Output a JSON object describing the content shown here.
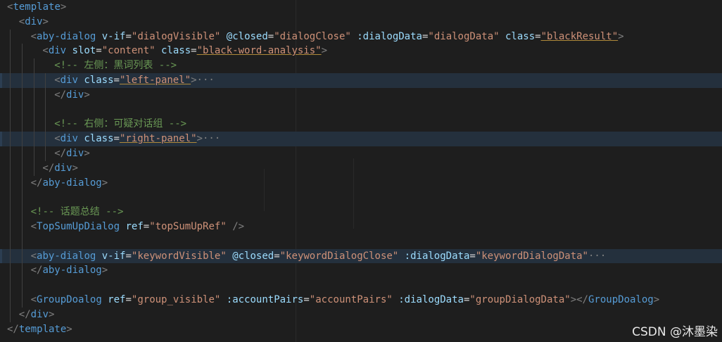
{
  "colors": {
    "background": "#1e1e1e",
    "tag": "#569cd6",
    "bracket": "#808080",
    "attr": "#9cdcfe",
    "equals": "#d4d4d4",
    "string": "#ce9178",
    "comment": "#6a9955",
    "fold": "#808080",
    "highlight": "#24303d"
  },
  "code_lines": [
    {
      "indent": 0,
      "tokens": [
        {
          "t": "<",
          "c": "bracket"
        },
        {
          "t": "template",
          "c": "tag"
        },
        {
          "t": ">",
          "c": "bracket"
        }
      ]
    },
    {
      "indent": 1,
      "tokens": [
        {
          "t": "<",
          "c": "bracket"
        },
        {
          "t": "div",
          "c": "tag"
        },
        {
          "t": ">",
          "c": "bracket"
        }
      ]
    },
    {
      "indent": 2,
      "tokens": [
        {
          "t": "<",
          "c": "bracket"
        },
        {
          "t": "aby-dialog",
          "c": "tag"
        },
        {
          "t": " v-if",
          "c": "attr"
        },
        {
          "t": "=",
          "c": "equals"
        },
        {
          "t": "\"dialogVisible\"",
          "c": "string"
        },
        {
          "t": " @closed",
          "c": "attr"
        },
        {
          "t": "=",
          "c": "equals"
        },
        {
          "t": "\"dialogClose\"",
          "c": "string"
        },
        {
          "t": " :dialogData",
          "c": "attr"
        },
        {
          "t": "=",
          "c": "equals"
        },
        {
          "t": "\"dialogData\"",
          "c": "string"
        },
        {
          "t": " class",
          "c": "attr"
        },
        {
          "t": "=",
          "c": "equals"
        },
        {
          "t": "\"blackResult\"",
          "c": "string"
        },
        {
          "t": ">",
          "c": "bracket"
        }
      ]
    },
    {
      "indent": 3,
      "tokens": [
        {
          "t": "<",
          "c": "bracket"
        },
        {
          "t": "div",
          "c": "tag"
        },
        {
          "t": " slot",
          "c": "attr"
        },
        {
          "t": "=",
          "c": "equals"
        },
        {
          "t": "\"content\"",
          "c": "string"
        },
        {
          "t": " class",
          "c": "attr"
        },
        {
          "t": "=",
          "c": "equals"
        },
        {
          "t": "\"black-word-analysis\"",
          "c": "string"
        },
        {
          "t": ">",
          "c": "bracket"
        }
      ]
    },
    {
      "indent": 4,
      "tokens": [
        {
          "t": "<!-- 左侧：黑词列表 -->",
          "c": "comment"
        }
      ]
    },
    {
      "indent": 4,
      "highlight": true,
      "tokens": [
        {
          "t": "<",
          "c": "bracket"
        },
        {
          "t": "div",
          "c": "tag"
        },
        {
          "t": " class",
          "c": "attr"
        },
        {
          "t": "=",
          "c": "equals"
        },
        {
          "t": "\"left-panel\"",
          "c": "string"
        },
        {
          "t": ">",
          "c": "bracket"
        },
        {
          "t": "···",
          "c": "fold"
        }
      ]
    },
    {
      "indent": 4,
      "tokens": [
        {
          "t": "</",
          "c": "bracket"
        },
        {
          "t": "div",
          "c": "tag"
        },
        {
          "t": ">",
          "c": "bracket"
        }
      ]
    },
    {
      "indent": 0,
      "tokens": []
    },
    {
      "indent": 4,
      "tokens": [
        {
          "t": "<!-- 右侧：可疑对话组 -->",
          "c": "comment"
        }
      ]
    },
    {
      "indent": 4,
      "highlight": true,
      "tokens": [
        {
          "t": "<",
          "c": "bracket"
        },
        {
          "t": "div",
          "c": "tag"
        },
        {
          "t": " class",
          "c": "attr"
        },
        {
          "t": "=",
          "c": "equals"
        },
        {
          "t": "\"right-panel\"",
          "c": "string"
        },
        {
          "t": ">",
          "c": "bracket"
        },
        {
          "t": "···",
          "c": "fold"
        }
      ]
    },
    {
      "indent": 4,
      "tokens": [
        {
          "t": "</",
          "c": "bracket"
        },
        {
          "t": "div",
          "c": "tag"
        },
        {
          "t": ">",
          "c": "bracket"
        }
      ]
    },
    {
      "indent": 3,
      "tokens": [
        {
          "t": "</",
          "c": "bracket"
        },
        {
          "t": "div",
          "c": "tag"
        },
        {
          "t": ">",
          "c": "bracket"
        }
      ]
    },
    {
      "indent": 2,
      "tokens": [
        {
          "t": "</",
          "c": "bracket"
        },
        {
          "t": "aby-dialog",
          "c": "tag"
        },
        {
          "t": ">",
          "c": "bracket"
        }
      ]
    },
    {
      "indent": 0,
      "tokens": []
    },
    {
      "indent": 2,
      "tokens": [
        {
          "t": "<!-- 话题总结 -->",
          "c": "comment"
        }
      ]
    },
    {
      "indent": 2,
      "tokens": [
        {
          "t": "<",
          "c": "bracket"
        },
        {
          "t": "TopSumUpDialog",
          "c": "tag"
        },
        {
          "t": " ref",
          "c": "attr"
        },
        {
          "t": "=",
          "c": "equals"
        },
        {
          "t": "\"topSumUpRef\"",
          "c": "string"
        },
        {
          "t": " />",
          "c": "bracket"
        }
      ]
    },
    {
      "indent": 0,
      "tokens": []
    },
    {
      "indent": 2,
      "highlight": true,
      "tokens": [
        {
          "t": "<",
          "c": "bracket"
        },
        {
          "t": "aby-dialog",
          "c": "tag"
        },
        {
          "t": " v-if",
          "c": "attr"
        },
        {
          "t": "=",
          "c": "equals"
        },
        {
          "t": "\"keywordVisible\"",
          "c": "string"
        },
        {
          "t": " @closed",
          "c": "attr"
        },
        {
          "t": "=",
          "c": "equals"
        },
        {
          "t": "\"keywordDialogClose\"",
          "c": "string"
        },
        {
          "t": " :dialogData",
          "c": "attr"
        },
        {
          "t": "=",
          "c": "equals"
        },
        {
          "t": "\"keywordDialogData\"",
          "c": "string"
        },
        {
          "t": "···",
          "c": "fold"
        }
      ]
    },
    {
      "indent": 2,
      "tokens": [
        {
          "t": "</",
          "c": "bracket"
        },
        {
          "t": "aby-dialog",
          "c": "tag"
        },
        {
          "t": ">",
          "c": "bracket"
        }
      ]
    },
    {
      "indent": 0,
      "tokens": []
    },
    {
      "indent": 2,
      "tokens": [
        {
          "t": "<",
          "c": "bracket"
        },
        {
          "t": "GroupDoalog",
          "c": "tag"
        },
        {
          "t": " ref",
          "c": "attr"
        },
        {
          "t": "=",
          "c": "equals"
        },
        {
          "t": "\"group_visible\"",
          "c": "string"
        },
        {
          "t": " :accountPairs",
          "c": "attr"
        },
        {
          "t": "=",
          "c": "equals"
        },
        {
          "t": "\"accountPairs\"",
          "c": "string"
        },
        {
          "t": " :dialogData",
          "c": "attr"
        },
        {
          "t": "=",
          "c": "equals"
        },
        {
          "t": "\"groupDialogData\"",
          "c": "string"
        },
        {
          "t": "></",
          "c": "bracket"
        },
        {
          "t": "GroupDoalog",
          "c": "tag"
        },
        {
          "t": ">",
          "c": "bracket"
        }
      ]
    },
    {
      "indent": 1,
      "tokens": [
        {
          "t": "</",
          "c": "bracket"
        },
        {
          "t": "div",
          "c": "tag"
        },
        {
          "t": ">",
          "c": "bracket"
        }
      ]
    },
    {
      "indent": 0,
      "tokens": [
        {
          "t": "</",
          "c": "bracket"
        },
        {
          "t": "template",
          "c": "tag"
        },
        {
          "t": ">",
          "c": "bracket"
        }
      ]
    }
  ],
  "watermark": "CSDN @沐墨染"
}
